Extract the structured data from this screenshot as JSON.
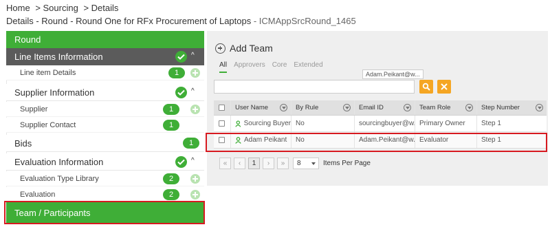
{
  "breadcrumb": [
    "Home",
    "> Sourcing",
    "> Details"
  ],
  "title": {
    "main": "Details - Round - Round One for RFx Procurement of Laptops",
    "id": "- ICMAppSrcRound_1465"
  },
  "sidebar": {
    "round": "Round",
    "line_items": {
      "label": "Line Items Information",
      "caret": "^"
    },
    "line_item_details": {
      "label": "Line item Details",
      "count": "1"
    },
    "supplier_info": {
      "label": "Supplier Information",
      "caret": "^"
    },
    "supplier": {
      "label": "Supplier",
      "count": "1"
    },
    "supplier_contact": {
      "label": "Supplier Contact",
      "count": "1"
    },
    "bids": {
      "label": "Bids",
      "count": "1"
    },
    "evaluation_info": {
      "label": "Evaluation Information",
      "caret": "^"
    },
    "evaluation_type_library": {
      "label": "Evaluation Type Library",
      "count": "2"
    },
    "evaluation": {
      "label": "Evaluation",
      "count": "2"
    },
    "team": "Team / Participants"
  },
  "panel": {
    "add_team": "Add Team",
    "tabs": [
      "All",
      "Approvers",
      "Core",
      "Extended"
    ],
    "tooltip": "Adam.Peikant@w...",
    "search_placeholder": ""
  },
  "table": {
    "headers": [
      "User Name",
      "By Rule",
      "Email ID",
      "Team Role",
      "Step Number"
    ],
    "rows": [
      [
        "Sourcing Buyer",
        "No",
        "sourcingbuyer@w...",
        "Primary Owner",
        "Step 1"
      ],
      [
        "Adam Peikant",
        "No",
        "Adam.Peikant@w...",
        "Evaluator",
        "Step 1"
      ]
    ]
  },
  "pager": {
    "first": "«",
    "prev": "‹",
    "page": "1",
    "next": "›",
    "last": "»",
    "per_page": "8",
    "per_page_label": "Items Per Page"
  },
  "colors": {
    "green": "#3fae37",
    "dark": "#5b5b5b",
    "orange": "#f5a623",
    "highlight": "#d71920"
  }
}
